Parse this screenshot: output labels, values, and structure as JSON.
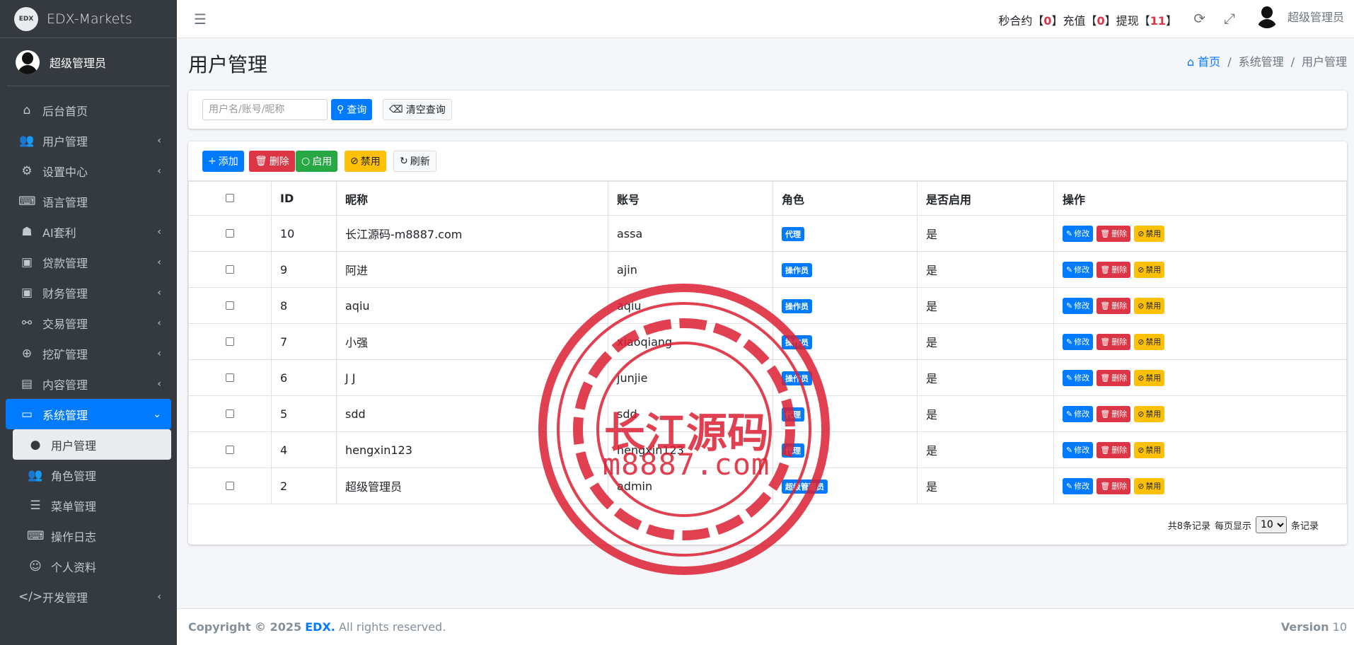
{
  "brand": {
    "logo_text": "EDX",
    "name": "EDX-Markets"
  },
  "user": {
    "name": "超级管理员"
  },
  "sidebar": {
    "items": [
      {
        "label": "后台首页",
        "icon": "home-icon",
        "glyph": "⌂",
        "arrow": ""
      },
      {
        "label": "用户管理",
        "icon": "users-icon",
        "glyph": "👥",
        "arrow": "‹"
      },
      {
        "label": "设置中心",
        "icon": "cogs-icon",
        "glyph": "⚙",
        "arrow": "‹"
      },
      {
        "label": "语言管理",
        "icon": "language-icon",
        "glyph": "⌨",
        "arrow": ""
      },
      {
        "label": "AI套利",
        "icon": "robot-icon",
        "glyph": "☗",
        "arrow": "‹"
      },
      {
        "label": "贷款管理",
        "icon": "money-icon",
        "glyph": "▣",
        "arrow": "‹"
      },
      {
        "label": "财务管理",
        "icon": "money-bill-icon",
        "glyph": "▣",
        "arrow": "‹"
      },
      {
        "label": "交易管理",
        "icon": "exchange-icon",
        "glyph": "⚯",
        "arrow": "‹"
      },
      {
        "label": "挖矿管理",
        "icon": "search-plus-icon",
        "glyph": "⊕",
        "arrow": "‹"
      },
      {
        "label": "内容管理",
        "icon": "newspaper-icon",
        "glyph": "▤",
        "arrow": "‹"
      },
      {
        "label": "系统管理",
        "icon": "desktop-icon",
        "glyph": "▭",
        "arrow": "⌄"
      }
    ],
    "sub_items": [
      {
        "label": "用户管理",
        "icon": "user-icon",
        "glyph": "●"
      },
      {
        "label": "角色管理",
        "icon": "users-icon",
        "glyph": "👥"
      },
      {
        "label": "菜单管理",
        "icon": "list-icon",
        "glyph": "☰"
      },
      {
        "label": "操作日志",
        "icon": "keyboard-icon",
        "glyph": "⌨"
      },
      {
        "label": "个人资料",
        "icon": "smile-icon",
        "glyph": "☺"
      }
    ],
    "last_item": {
      "label": "开发管理",
      "icon": "code-icon",
      "glyph": "</>",
      "arrow": "‹"
    }
  },
  "topbar": {
    "stats": [
      {
        "label": "秒合约",
        "value": "0"
      },
      {
        "label": "充值",
        "value": "0"
      },
      {
        "label": "提现",
        "value": "11"
      }
    ]
  },
  "page": {
    "title": "用户管理",
    "breadcrumb": {
      "home": "首页",
      "level1": "系统管理",
      "level2": "用户管理"
    }
  },
  "search": {
    "placeholder": "用户名/账号/昵称",
    "query_label": "查询",
    "clear_label": "清空查询"
  },
  "toolbar": {
    "add_label": "添加",
    "delete_label": "删除",
    "enable_label": "启用",
    "disable_label": "禁用",
    "refresh_label": "刷新"
  },
  "table": {
    "headers": {
      "id": "ID",
      "nickname": "昵称",
      "account": "账号",
      "role": "角色",
      "enabled": "是否启用",
      "actions": "操作"
    },
    "action_labels": {
      "edit": "修改",
      "delete": "删除",
      "disable": "禁用"
    },
    "rows": [
      {
        "id": "10",
        "nickname": "长江源码-m8887.com",
        "account": "assa",
        "role": "代理",
        "enabled": "是"
      },
      {
        "id": "9",
        "nickname": "阿进",
        "account": "ajin",
        "role": "操作员",
        "enabled": "是"
      },
      {
        "id": "8",
        "nickname": "aqiu",
        "account": "aqiu",
        "role": "操作员",
        "enabled": "是"
      },
      {
        "id": "7",
        "nickname": "小强",
        "account": "xiaoqiang",
        "role": "操作员",
        "enabled": "是"
      },
      {
        "id": "6",
        "nickname": "J J",
        "account": "junjie",
        "role": "操作员",
        "enabled": "是"
      },
      {
        "id": "5",
        "nickname": "sdd",
        "account": "sdd",
        "role": "代理",
        "enabled": "是"
      },
      {
        "id": "4",
        "nickname": "hengxin123",
        "account": "hengxin123",
        "role": "代理",
        "enabled": "是"
      },
      {
        "id": "2",
        "nickname": "超级管理员",
        "account": "admin",
        "role": "超级管理员",
        "enabled": "是"
      }
    ]
  },
  "pagination": {
    "total_text": "共8条记录",
    "per_page_prefix": "每页显示",
    "per_page_value": "10",
    "per_page_suffix": "条记录"
  },
  "footer": {
    "copyright_prefix": "Copyright © 2025",
    "brand": "EDX.",
    "rights": "All rights reserved.",
    "version_label": "Version",
    "version_value": "10"
  },
  "watermark": {
    "text1": "长江源码",
    "text2": "m8887.com"
  },
  "colors": {
    "sidebar_bg": "#343a40",
    "primary": "#007bff",
    "danger": "#dc3545",
    "success": "#28a745",
    "warning": "#ffc107",
    "stamp_red": "#dc1e32"
  }
}
